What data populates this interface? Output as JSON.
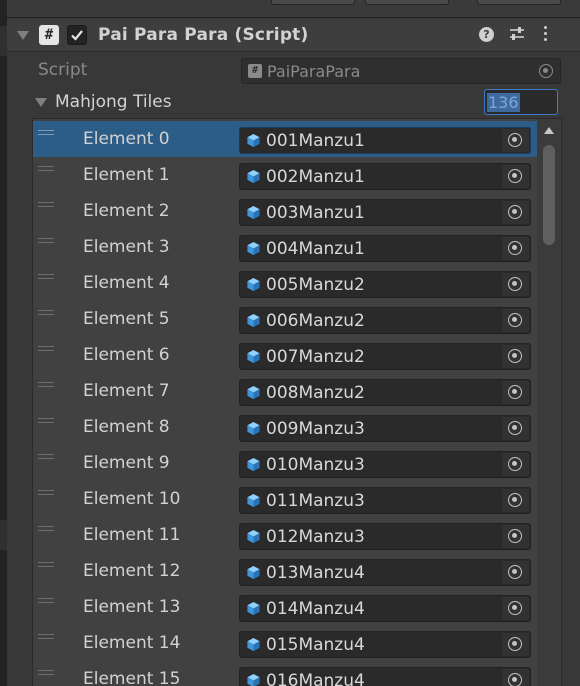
{
  "component": {
    "title": "Pai Para Para (Script)",
    "enabled_icon": "checkmark-icon",
    "script_icon": "hash-icon",
    "help_icon": "question-icon",
    "preset_icon": "sliders-icon",
    "menu_icon": "kebab-menu-icon"
  },
  "script_row": {
    "label": "Script",
    "value": "PaiParaPara"
  },
  "list": {
    "label": "Mahjong Tiles",
    "size": "136",
    "rows": [
      {
        "label": "Element 0",
        "value": "001Manzu1"
      },
      {
        "label": "Element 1",
        "value": "002Manzu1"
      },
      {
        "label": "Element 2",
        "value": "003Manzu1"
      },
      {
        "label": "Element 3",
        "value": "004Manzu1"
      },
      {
        "label": "Element 4",
        "value": "005Manzu2"
      },
      {
        "label": "Element 5",
        "value": "006Manzu2"
      },
      {
        "label": "Element 6",
        "value": "007Manzu2"
      },
      {
        "label": "Element 7",
        "value": "008Manzu2"
      },
      {
        "label": "Element 8",
        "value": "009Manzu3"
      },
      {
        "label": "Element 9",
        "value": "010Manzu3"
      },
      {
        "label": "Element 10",
        "value": "011Manzu3"
      },
      {
        "label": "Element 11",
        "value": "012Manzu3"
      },
      {
        "label": "Element 12",
        "value": "013Manzu4"
      },
      {
        "label": "Element 13",
        "value": "014Manzu4"
      },
      {
        "label": "Element 14",
        "value": "015Manzu4"
      },
      {
        "label": "Element 15",
        "value": "016Manzu4"
      }
    ],
    "selected_index": 0
  },
  "colors": {
    "panel_bg": "#383838",
    "selection": "#2c5d87",
    "focus_outline": "#3d7cc9",
    "prefab_icon": "#4aa3e8"
  }
}
